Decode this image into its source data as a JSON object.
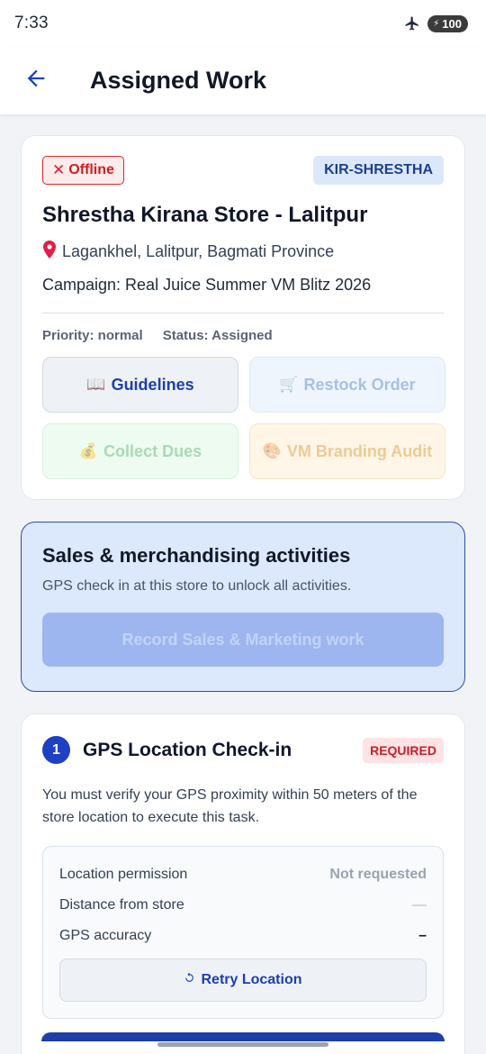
{
  "status_bar": {
    "time": "7:33",
    "battery": "100"
  },
  "header": {
    "title": "Assigned Work"
  },
  "store": {
    "offline_label": "Offline",
    "code": "KIR-SHRESTHA",
    "name": "Shrestha Kirana Store - Lalitpur",
    "address": "Lagankhel, Lalitpur, Bagmati Province",
    "campaign": "Campaign: Real Juice Summer VM Blitz 2026",
    "priority": "Priority: normal",
    "status": "Status: Assigned",
    "actions": {
      "guidelines": "Guidelines",
      "restock": "Restock Order",
      "dues": "Collect Dues",
      "audit": "VM Branding Audit"
    }
  },
  "sales": {
    "title": "Sales & merchandising activities",
    "subtitle": "GPS check in at this store to unlock all activities.",
    "record_label": "Record Sales & Marketing work"
  },
  "gps": {
    "step": "1",
    "title": "GPS Location Check-in",
    "required": "REQUIRED",
    "description": "You must verify your GPS proximity within 50 meters of the store location to execute this task.",
    "rows": [
      {
        "label": "Location permission",
        "value": "Not requested"
      },
      {
        "label": "Distance from store",
        "value": "—"
      },
      {
        "label": "GPS accuracy",
        "value": "–"
      }
    ],
    "retry_label": "Retry Location"
  },
  "colors": {
    "primary": "#1e40c4",
    "offline_red": "#dc2626",
    "sales_bg": "#dce8fb"
  },
  "icons": {
    "back": "arrow-left-icon",
    "airplane": "airplane-icon",
    "pin": "location-pin-icon",
    "book": "book-icon",
    "cart": "cart-icon",
    "money": "money-bag-icon",
    "palette": "palette-icon",
    "refresh": "refresh-icon"
  }
}
